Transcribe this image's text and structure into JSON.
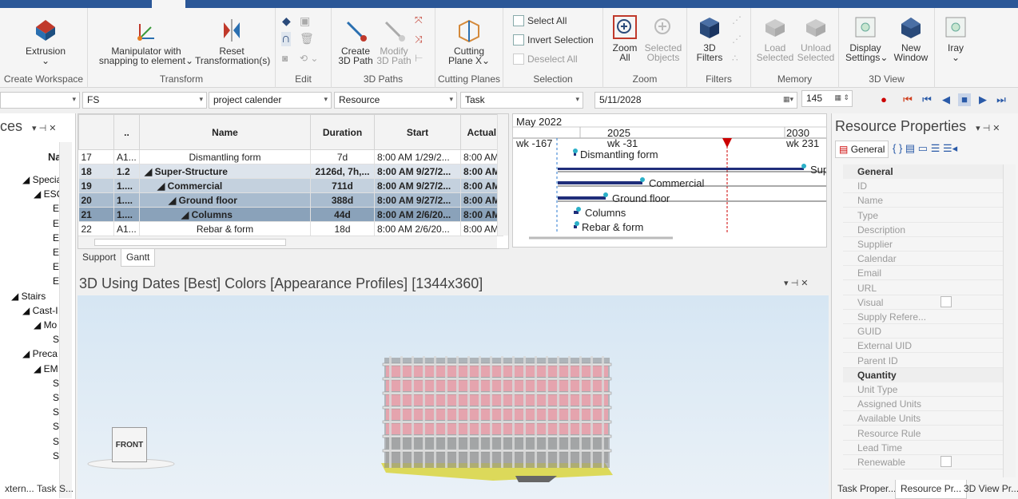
{
  "ribbon": {
    "groups": [
      {
        "label": "Create Workspace"
      },
      {
        "label": "Transform"
      },
      {
        "label": "Edit"
      },
      {
        "label": "3D Paths"
      },
      {
        "label": "Cutting Planes"
      },
      {
        "label": "Selection"
      },
      {
        "label": "Zoom"
      },
      {
        "label": "Filters"
      },
      {
        "label": "Memory"
      },
      {
        "label": "3D View"
      }
    ],
    "extrusion": {
      "line1": "Extrusion",
      "line2": "⌄"
    },
    "manipulator": {
      "line1": "Manipulator with",
      "line2": "snapping to element⌄"
    },
    "reset": {
      "line1": "Reset",
      "line2": "Transformation(s)"
    },
    "create_path": {
      "line1": "Create",
      "line2": "3D Path"
    },
    "modify_path": {
      "line1": "Modify",
      "line2": "3D Path"
    },
    "cutting_plane": {
      "line1": "Cutting",
      "line2": "Plane X⌄"
    },
    "select_all": "Select All",
    "invert_selection": "Invert Selection",
    "deselect_all": "Deselect All",
    "zoom_all": {
      "line1": "Zoom",
      "line2": "All"
    },
    "selected_objects": {
      "line1": "Selected",
      "line2": "Objects"
    },
    "filters_3d": {
      "line1": "3D",
      "line2": "Filters"
    },
    "load_selected": {
      "line1": "Load",
      "line2": "Selected"
    },
    "unload_selected": {
      "line1": "Unload",
      "line2": "Selected"
    },
    "display_settings": {
      "line1": "Display",
      "line2": "Settings⌄"
    },
    "new_window": {
      "line1": "New",
      "line2": "Window"
    },
    "iray": {
      "line1": "Iray",
      "line2": "⌄"
    }
  },
  "filterbar": {
    "fs": "FS",
    "calendar": "project calender",
    "resource": "Resource",
    "task": "Task",
    "date": "5/11/2028",
    "frame": "145"
  },
  "left_pane": {
    "title": "ces",
    "col_header": "Na",
    "rows": [
      "◢ Specia",
      "◢ ESC",
      "E",
      "E",
      "E",
      "E",
      "E",
      "E",
      "◢ Stairs",
      "◢ Cast-I",
      "◢ Mo",
      "S",
      "◢ Preca",
      "◢ EM",
      "S",
      "S",
      "S",
      "S",
      "S",
      "S"
    ]
  },
  "table": {
    "headers": [
      "..",
      "Name",
      "Duration",
      "Start",
      "Actual"
    ],
    "rows": [
      {
        "num": "17",
        "id": "A1...",
        "name": "Dismantling form",
        "dur": "7d",
        "start": "8:00 AM 1/29/2...",
        "actual": "8:00 AM",
        "level": "0"
      },
      {
        "num": "18",
        "id": "1.2",
        "name": "◢ Super-Structure",
        "dur": "2126d, 7h,...",
        "start": "8:00 AM 9/27/2...",
        "actual": "8:00 AM",
        "level": "1"
      },
      {
        "num": "19",
        "id": "1....",
        "name": "◢ Commercial",
        "dur": "711d",
        "start": "8:00 AM 9/27/2...",
        "actual": "8:00 AM",
        "level": "2"
      },
      {
        "num": "20",
        "id": "1....",
        "name": "◢ Ground floor",
        "dur": "388d",
        "start": "8:00 AM 9/27/2...",
        "actual": "8:00 AM",
        "level": "3"
      },
      {
        "num": "21",
        "id": "1....",
        "name": "◢ Columns",
        "dur": "44d",
        "start": "8:00 AM 2/6/20...",
        "actual": "8:00 AM",
        "level": "4"
      },
      {
        "num": "22",
        "id": "A1...",
        "name": "Rebar & form",
        "dur": "18d",
        "start": "8:00 AM 2/6/20...",
        "actual": "8:00 AM",
        "level": "0"
      }
    ]
  },
  "gantt": {
    "top_label": "May 2022",
    "years": [
      "2025",
      "2030"
    ],
    "weeks": [
      "wk -167",
      "wk -31",
      "wk 231"
    ],
    "bars": [
      "Dismantling form",
      "Sup",
      "Commercial",
      "Ground floor",
      "Columns",
      "Rebar & form"
    ]
  },
  "tabs": [
    "Support",
    "Gantt"
  ],
  "view": {
    "title": "3D Using Dates [Best] Colors [Appearance Profiles]  [1344x360]",
    "cube_label": "FRONT"
  },
  "properties": {
    "title": "Resource Properties",
    "tab_general": "General",
    "cat_general": "General",
    "fields_general": [
      "ID",
      "Name",
      "Type",
      "Description",
      "Supplier",
      "Calendar",
      "Email",
      "URL",
      "Visual",
      "Supply Refere...",
      "GUID",
      "External UID",
      "Parent ID"
    ],
    "cat_quantity": "Quantity",
    "fields_quantity": [
      "Unit Type",
      "Assigned Units",
      "Available Units",
      "Resource Rule",
      "Lead Time",
      "Renewable"
    ]
  },
  "bottom_tabs": [
    "xtern...",
    "Task S...",
    "Task Proper...",
    "Resource Pr...",
    "3D View Pr..."
  ],
  "colors": {
    "accent": "#2b5797",
    "building": "#e8a3ad",
    "gantt_bar": "#1f2d7a"
  }
}
